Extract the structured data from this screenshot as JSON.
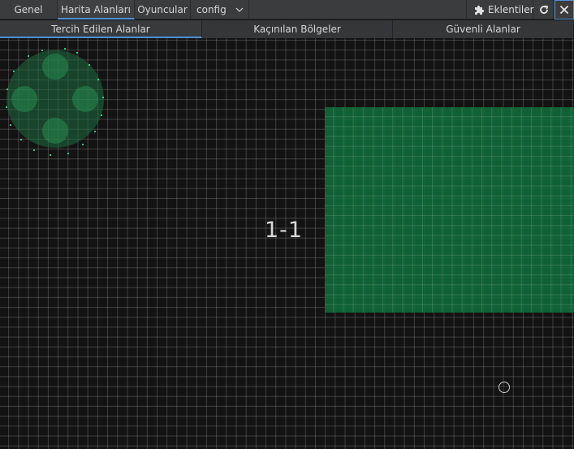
{
  "tabs": {
    "genel": "Genel",
    "harita_alanlari": "Harita Alanları",
    "oyuncular": "Oyuncular",
    "config_select": "config",
    "plugins_label": "Eklentiler"
  },
  "subtabs": {
    "preferred": "Tercih Edilen Alanlar",
    "avoided": "Kaçınılan Bölgeler",
    "safe": "Güvenli Alanlar"
  },
  "map": {
    "coordinate_label": "1-1",
    "zone_color": "#0f6e3c",
    "grid_color": "#8a8a8a"
  },
  "icons": {
    "plugins": "puzzle-icon",
    "refresh": "refresh-icon",
    "close": "close-icon",
    "dropdown": "chevron-down-icon"
  },
  "colors": {
    "accent": "#4f8fd6",
    "background": "#131313",
    "toolbar": "#3b3c3e"
  }
}
